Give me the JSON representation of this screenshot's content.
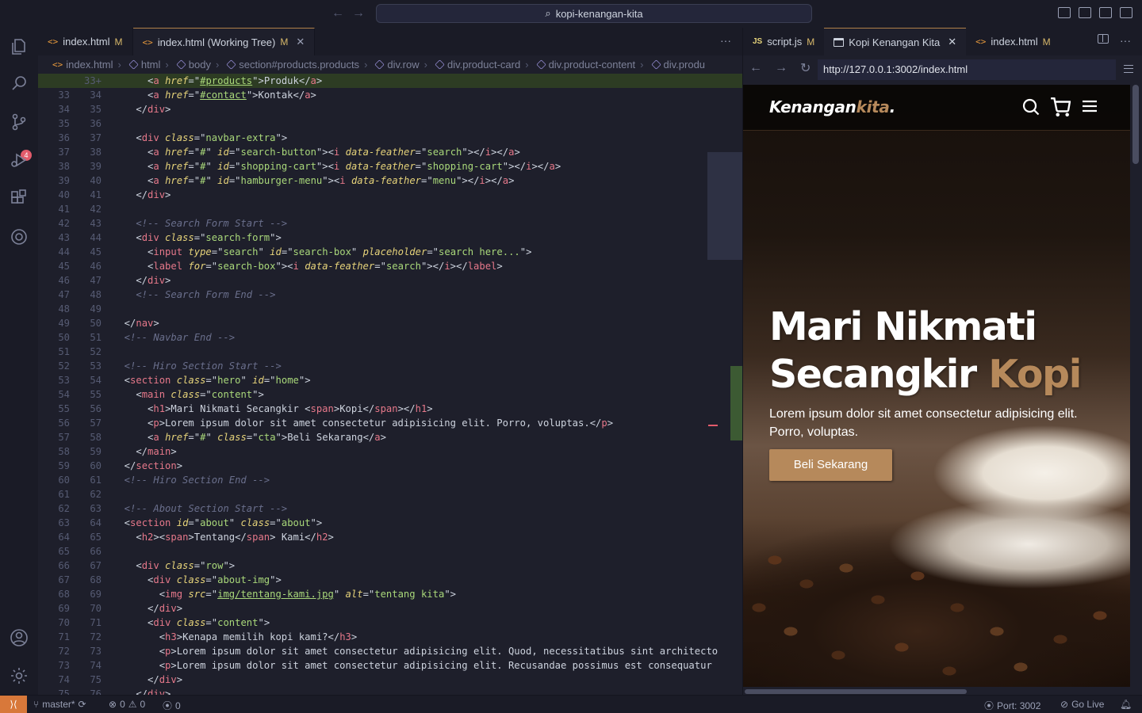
{
  "window": {
    "search_title": "kopi-kenangan-kita"
  },
  "activity_bar": {
    "scm_badge": "4"
  },
  "editor_tabs": [
    {
      "label": "index.html",
      "status": "M",
      "icon": "html-icon"
    },
    {
      "label": "index.html (Working Tree)",
      "status": "M",
      "icon": "html-icon"
    }
  ],
  "breadcrumb": [
    "index.html",
    "html",
    "body",
    "section#products.products",
    "div.row",
    "div.product-card",
    "div.product-content",
    "div.produ"
  ],
  "code_lines": [
    {
      "l": "",
      "r": "33",
      "html": "<span class=\"p\">      &lt;</span><span class=\"t\">a</span> <span class=\"a\">href</span><span class=\"p\">=\"</span><span class=\"s u\">#products</span><span class=\"p\">\"&gt;Produk&lt;/</span><span class=\"t\">a</span><span class=\"p\">&gt;</span>",
      "hl": true
    },
    {
      "l": "33",
      "r": "34",
      "html": "<span class=\"p\">      &lt;</span><span class=\"t\">a</span> <span class=\"a\">href</span><span class=\"p\">=\"</span><span class=\"s u\">#contact</span><span class=\"p\">\"&gt;Kontak&lt;/</span><span class=\"t\">a</span><span class=\"p\">&gt;</span>"
    },
    {
      "l": "34",
      "r": "35",
      "html": "<span class=\"p\">    &lt;/</span><span class=\"t\">div</span><span class=\"p\">&gt;</span>"
    },
    {
      "l": "35",
      "r": "36",
      "html": ""
    },
    {
      "l": "36",
      "r": "37",
      "html": "<span class=\"p\">    &lt;</span><span class=\"t\">div</span> <span class=\"a\">class</span><span class=\"p\">=\"</span><span class=\"s\">navbar-extra</span><span class=\"p\">\"&gt;</span>"
    },
    {
      "l": "37",
      "r": "38",
      "html": "<span class=\"p\">      &lt;</span><span class=\"t\">a</span> <span class=\"a\">href</span><span class=\"p\">=\"</span><span class=\"s\">#</span><span class=\"p\">\" </span><span class=\"a\">id</span><span class=\"p\">=\"</span><span class=\"s\">search-button</span><span class=\"p\">\"&gt;&lt;</span><span class=\"t\">i</span> <span class=\"a\">data-feather</span><span class=\"p\">=\"</span><span class=\"s\">search</span><span class=\"p\">\"&gt;&lt;/</span><span class=\"t\">i</span><span class=\"p\">&gt;&lt;/</span><span class=\"t\">a</span><span class=\"p\">&gt;</span>"
    },
    {
      "l": "38",
      "r": "39",
      "html": "<span class=\"p\">      &lt;</span><span class=\"t\">a</span> <span class=\"a\">href</span><span class=\"p\">=\"</span><span class=\"s\">#</span><span class=\"p\">\" </span><span class=\"a\">id</span><span class=\"p\">=\"</span><span class=\"s\">shopping-cart</span><span class=\"p\">\"&gt;&lt;</span><span class=\"t\">i</span> <span class=\"a\">data-feather</span><span class=\"p\">=\"</span><span class=\"s\">shopping-cart</span><span class=\"p\">\"&gt;&lt;/</span><span class=\"t\">i</span><span class=\"p\">&gt;&lt;/</span><span class=\"t\">a</span><span class=\"p\">&gt;</span>"
    },
    {
      "l": "39",
      "r": "40",
      "html": "<span class=\"p\">      &lt;</span><span class=\"t\">a</span> <span class=\"a\">href</span><span class=\"p\">=\"</span><span class=\"s\">#</span><span class=\"p\">\" </span><span class=\"a\">id</span><span class=\"p\">=\"</span><span class=\"s\">hamburger-menu</span><span class=\"p\">\"&gt;&lt;</span><span class=\"t\">i</span> <span class=\"a\">data-feather</span><span class=\"p\">=\"</span><span class=\"s\">menu</span><span class=\"p\">\"&gt;&lt;/</span><span class=\"t\">i</span><span class=\"p\">&gt;&lt;/</span><span class=\"t\">a</span><span class=\"p\">&gt;</span>"
    },
    {
      "l": "40",
      "r": "41",
      "html": "<span class=\"p\">    &lt;/</span><span class=\"t\">div</span><span class=\"p\">&gt;</span>"
    },
    {
      "l": "41",
      "r": "42",
      "html": ""
    },
    {
      "l": "42",
      "r": "43",
      "html": "<span class=\"c\">    &lt;!-- Search Form Start --&gt;</span>"
    },
    {
      "l": "43",
      "r": "44",
      "html": "<span class=\"p\">    &lt;</span><span class=\"t\">div</span> <span class=\"a\">class</span><span class=\"p\">=\"</span><span class=\"s\">search-form</span><span class=\"p\">\"&gt;</span>"
    },
    {
      "l": "44",
      "r": "45",
      "html": "<span class=\"p\">      &lt;</span><span class=\"t\">input</span> <span class=\"a\">type</span><span class=\"p\">=\"</span><span class=\"s\">search</span><span class=\"p\">\" </span><span class=\"a\">id</span><span class=\"p\">=\"</span><span class=\"s\">search-box</span><span class=\"p\">\" </span><span class=\"a\">placeholder</span><span class=\"p\">=\"</span><span class=\"s\">search here...</span><span class=\"p\">\"&gt;</span>"
    },
    {
      "l": "45",
      "r": "46",
      "html": "<span class=\"p\">      &lt;</span><span class=\"t\">label</span> <span class=\"a\">for</span><span class=\"p\">=\"</span><span class=\"s\">search-box</span><span class=\"p\">\"&gt;&lt;</span><span class=\"t\">i</span> <span class=\"a\">data-feather</span><span class=\"p\">=\"</span><span class=\"s\">search</span><span class=\"p\">\"&gt;&lt;/</span><span class=\"t\">i</span><span class=\"p\">&gt;&lt;/</span><span class=\"t\">label</span><span class=\"p\">&gt;</span>"
    },
    {
      "l": "46",
      "r": "47",
      "html": "<span class=\"p\">    &lt;/</span><span class=\"t\">div</span><span class=\"p\">&gt;</span>"
    },
    {
      "l": "47",
      "r": "48",
      "html": "<span class=\"c\">    &lt;!-- Search Form End --&gt;</span>"
    },
    {
      "l": "48",
      "r": "49",
      "html": ""
    },
    {
      "l": "49",
      "r": "50",
      "html": "<span class=\"p\">  &lt;/</span><span class=\"t\">nav</span><span class=\"p\">&gt;</span>"
    },
    {
      "l": "50",
      "r": "51",
      "html": "<span class=\"c\">  &lt;!-- Navbar End --&gt;</span>"
    },
    {
      "l": "51",
      "r": "52",
      "html": ""
    },
    {
      "l": "52",
      "r": "53",
      "html": "<span class=\"c\">  &lt;!-- Hiro Section Start --&gt;</span>"
    },
    {
      "l": "53",
      "r": "54",
      "html": "<span class=\"p\">  &lt;</span><span class=\"t\">section</span> <span class=\"a\">class</span><span class=\"p\">=\"</span><span class=\"s\">hero</span><span class=\"p\">\" </span><span class=\"a\">id</span><span class=\"p\">=\"</span><span class=\"s\">home</span><span class=\"p\">\"&gt;</span>"
    },
    {
      "l": "54",
      "r": "55",
      "html": "<span class=\"p\">    &lt;</span><span class=\"t\">main</span> <span class=\"a\">class</span><span class=\"p\">=\"</span><span class=\"s\">content</span><span class=\"p\">\"&gt;</span>"
    },
    {
      "l": "55",
      "r": "56",
      "html": "<span class=\"p\">      &lt;</span><span class=\"t\">h1</span><span class=\"p\">&gt;Mari Nikmati Secangkir &lt;</span><span class=\"t\">span</span><span class=\"p\">&gt;Kopi&lt;/</span><span class=\"t\">span</span><span class=\"p\">&gt;&lt;/</span><span class=\"t\">h1</span><span class=\"p\">&gt;</span>"
    },
    {
      "l": "56",
      "r": "57",
      "html": "<span class=\"p\">      &lt;</span><span class=\"t\">p</span><span class=\"p\">&gt;Lorem ipsum dolor sit amet consectetur adipisicing elit. Porro, voluptas.&lt;/</span><span class=\"t\">p</span><span class=\"p\">&gt;</span>"
    },
    {
      "l": "57",
      "r": "58",
      "html": "<span class=\"p\">      &lt;</span><span class=\"t\">a</span> <span class=\"a\">href</span><span class=\"p\">=\"</span><span class=\"s\">#</span><span class=\"p\">\" </span><span class=\"a\">class</span><span class=\"p\">=\"</span><span class=\"s\">cta</span><span class=\"p\">\"&gt;Beli Sekarang&lt;/</span><span class=\"t\">a</span><span class=\"p\">&gt;</span>"
    },
    {
      "l": "58",
      "r": "59",
      "html": "<span class=\"p\">    &lt;/</span><span class=\"t\">main</span><span class=\"p\">&gt;</span>"
    },
    {
      "l": "59",
      "r": "60",
      "html": "<span class=\"p\">  &lt;/</span><span class=\"t\">section</span><span class=\"p\">&gt;</span>"
    },
    {
      "l": "60",
      "r": "61",
      "html": "<span class=\"c\">  &lt;!-- Hiro Section End --&gt;</span>"
    },
    {
      "l": "61",
      "r": "62",
      "html": ""
    },
    {
      "l": "62",
      "r": "63",
      "html": "<span class=\"c\">  &lt;!-- About Section Start --&gt;</span>"
    },
    {
      "l": "63",
      "r": "64",
      "html": "<span class=\"p\">  &lt;</span><span class=\"t\">section</span> <span class=\"a\">id</span><span class=\"p\">=\"</span><span class=\"s\">about</span><span class=\"p\">\" </span><span class=\"a\">class</span><span class=\"p\">=\"</span><span class=\"s\">about</span><span class=\"p\">\"&gt;</span>"
    },
    {
      "l": "64",
      "r": "65",
      "html": "<span class=\"p\">    &lt;</span><span class=\"t\">h2</span><span class=\"p\">&gt;&lt;</span><span class=\"t\">span</span><span class=\"p\">&gt;Tentang&lt;/</span><span class=\"t\">span</span><span class=\"p\">&gt; Kami&lt;/</span><span class=\"t\">h2</span><span class=\"p\">&gt;</span>"
    },
    {
      "l": "65",
      "r": "66",
      "html": ""
    },
    {
      "l": "66",
      "r": "67",
      "html": "<span class=\"p\">    &lt;</span><span class=\"t\">div</span> <span class=\"a\">class</span><span class=\"p\">=\"</span><span class=\"s\">row</span><span class=\"p\">\"&gt;</span>"
    },
    {
      "l": "67",
      "r": "68",
      "html": "<span class=\"p\">      &lt;</span><span class=\"t\">div</span> <span class=\"a\">class</span><span class=\"p\">=\"</span><span class=\"s\">about-img</span><span class=\"p\">\"&gt;</span>"
    },
    {
      "l": "68",
      "r": "69",
      "html": "<span class=\"p\">        &lt;</span><span class=\"t\">img</span> <span class=\"a\">src</span><span class=\"p\">=\"</span><span class=\"s u\">img/tentang-kami.jpg</span><span class=\"p\">\" </span><span class=\"a\">alt</span><span class=\"p\">=\"</span><span class=\"s\">tentang kita</span><span class=\"p\">\"&gt;</span>"
    },
    {
      "l": "69",
      "r": "70",
      "html": "<span class=\"p\">      &lt;/</span><span class=\"t\">div</span><span class=\"p\">&gt;</span>"
    },
    {
      "l": "70",
      "r": "71",
      "html": "<span class=\"p\">      &lt;</span><span class=\"t\">div</span> <span class=\"a\">class</span><span class=\"p\">=\"</span><span class=\"s\">content</span><span class=\"p\">\"&gt;</span>"
    },
    {
      "l": "71",
      "r": "72",
      "html": "<span class=\"p\">        &lt;</span><span class=\"t\">h3</span><span class=\"p\">&gt;Kenapa memilih kopi kami?&lt;/</span><span class=\"t\">h3</span><span class=\"p\">&gt;</span>"
    },
    {
      "l": "72",
      "r": "73",
      "html": "<span class=\"p\">        &lt;</span><span class=\"t\">p</span><span class=\"p\">&gt;Lorem ipsum dolor sit amet consectetur adipisicing elit. Quod, necessitatibus sint architecto</span>"
    },
    {
      "l": "73",
      "r": "74",
      "html": "<span class=\"p\">        &lt;</span><span class=\"t\">p</span><span class=\"p\">&gt;Lorem ipsum dolor sit amet consectetur adipisicing elit. Recusandae possimus est consequatur</span>"
    },
    {
      "l": "74",
      "r": "75",
      "html": "<span class=\"p\">      &lt;/</span><span class=\"t\">div</span><span class=\"p\">&gt;</span>"
    },
    {
      "l": "75",
      "r": "76",
      "html": "<span class=\"p\">    &lt;/</span><span class=\"t\">div</span><span class=\"p\">&gt;</span>"
    }
  ],
  "right_tabs": [
    {
      "label": "script.js",
      "status": "M",
      "icon": "js-icon"
    },
    {
      "label": "Kopi Kenangan Kita",
      "icon": "browser-icon"
    },
    {
      "label": "index.html",
      "status": "M",
      "icon": "html-icon"
    }
  ],
  "browser": {
    "url": "http://127.0.0.1:3002/index.html"
  },
  "webpage": {
    "logo_main": "Kenangan",
    "logo_accent": "kita",
    "logo_dot": ".",
    "hero_line1": "Mari Nikmati",
    "hero_line2": "Secangkir",
    "hero_accent": "Kopi",
    "hero_text": "Lorem ipsum dolor sit amet consectetur adipisicing elit. Porro, voluptas.",
    "cta": "Beli Sekarang",
    "accent_color": "#b6895b"
  },
  "statusbar": {
    "branch": "master*",
    "errors": "0",
    "warnings": "0",
    "ports": "0",
    "port_label": "Port: 3002",
    "go_live": "Go Live"
  }
}
